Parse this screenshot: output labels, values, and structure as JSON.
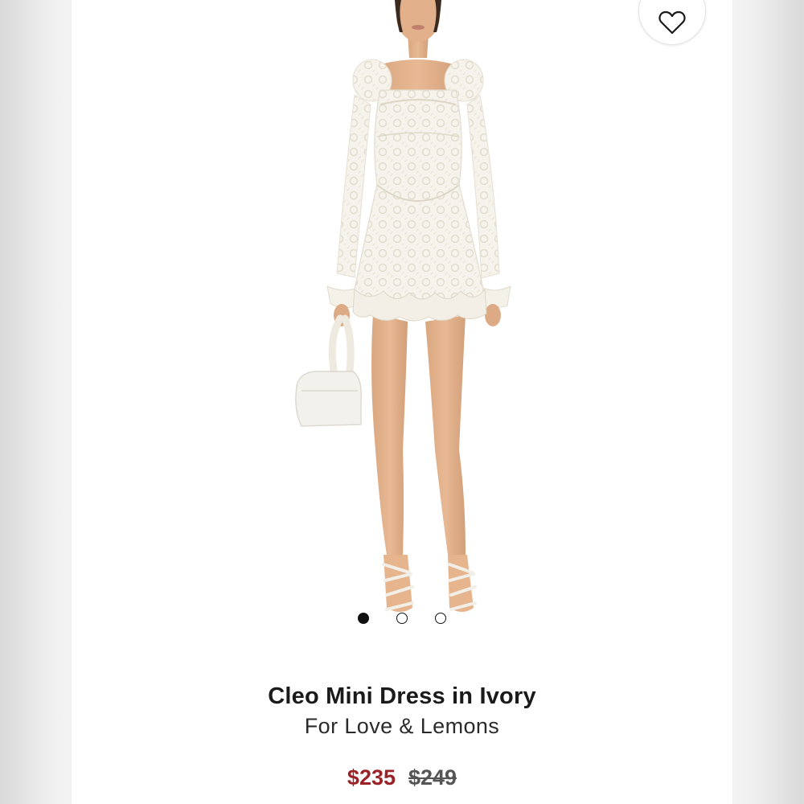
{
  "product": {
    "title": "Cleo Mini Dress in Ivory",
    "brand": "For Love & Lemons",
    "sale_price": "$235",
    "original_price": "$249"
  },
  "carousel": {
    "total_images": 3,
    "active_index": 0
  },
  "icons": {
    "favorite": "heart-outline-icon"
  },
  "colors": {
    "sale_price": "#9b2226",
    "text": "#1a1a1a",
    "dress": "#f7f5ef"
  }
}
